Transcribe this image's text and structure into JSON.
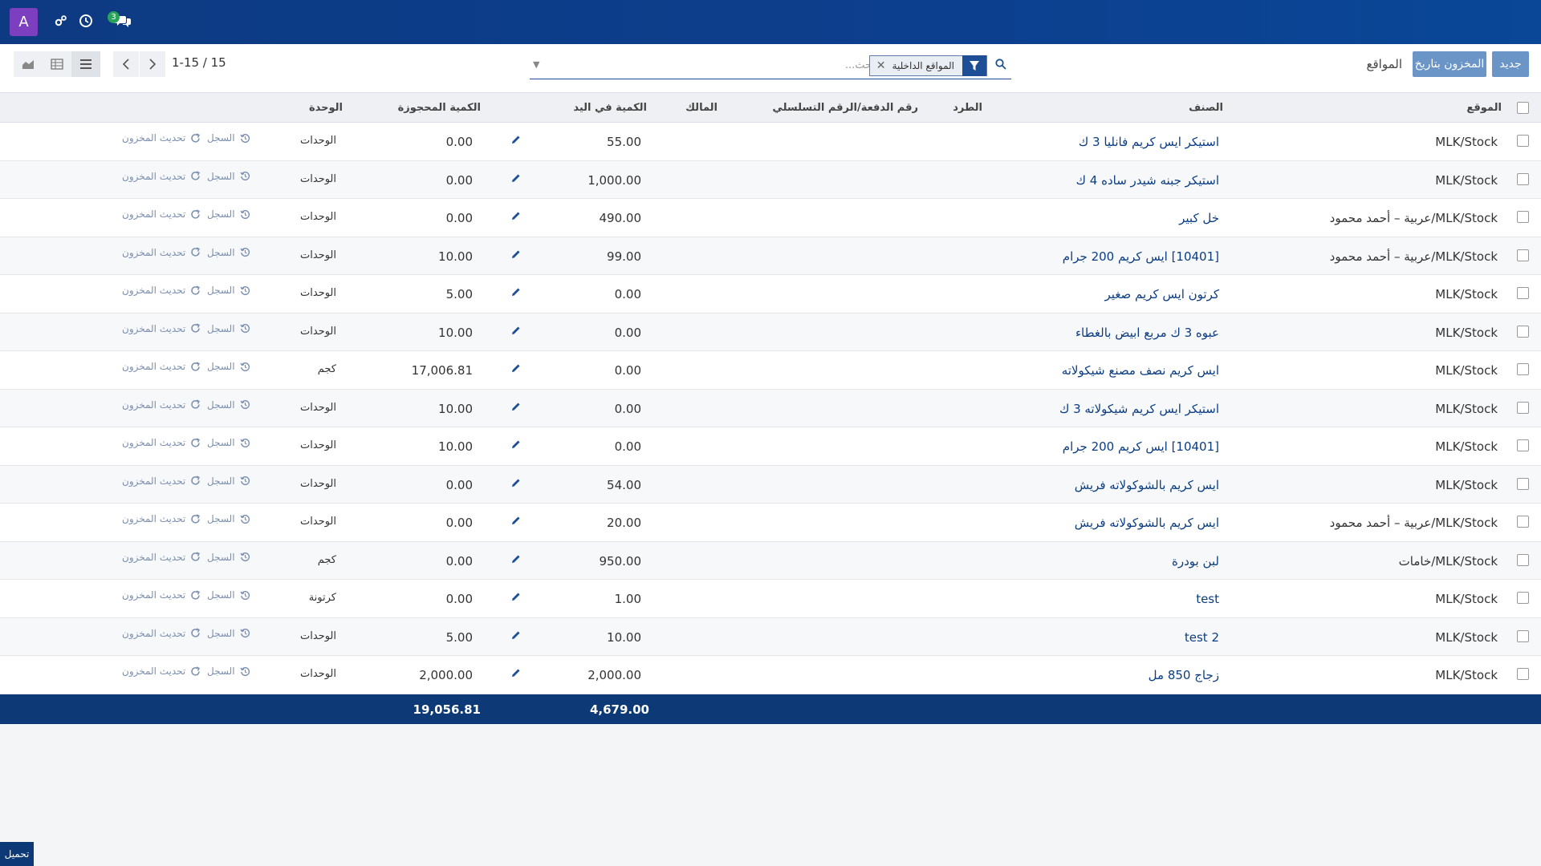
{
  "topbar": {
    "avatar_letter": "A",
    "icons": [
      "tools-icon",
      "clock-icon",
      "chat-icon"
    ],
    "chat_badge": "3",
    "color": "#0d3a82"
  },
  "control": {
    "new_button": "جديد",
    "inventory_at_date_button": "المخزون بتاريخ",
    "breadcrumb": "المواقع",
    "facet_label": "المواقع الداخلية",
    "search_placeholder": "بحث...",
    "pager_text": "1-15 / 15"
  },
  "columns": {
    "location": "الموقع",
    "product": "الصنف",
    "package": "الطرد",
    "lot": "رقم الدفعة/الرقم التسلسلي",
    "owner": "المالك",
    "on_hand": "الكمية في اليد",
    "reserved": "الكمية المحجوزة",
    "uom": "الوحدة"
  },
  "row_actions": {
    "history": "السجل",
    "update": "تحديث المخزون"
  },
  "rows": [
    {
      "location": "MLK/Stock",
      "product": "استيكر ايس كريم فانليا 3 ك",
      "on_hand": "55.00",
      "reserved": "0.00",
      "uom": "الوحدات"
    },
    {
      "location": "MLK/Stock",
      "product": "استيكر جبنه شيدر ساده 4 ك",
      "on_hand": "1,000.00",
      "reserved": "0.00",
      "uom": "الوحدات"
    },
    {
      "location": "MLK/Stock/عربية – أحمد محمود",
      "product": "خل كبير",
      "on_hand": "490.00",
      "reserved": "0.00",
      "uom": "الوحدات"
    },
    {
      "location": "MLK/Stock/عربية – أحمد محمود",
      "product": "[10401] ايس كريم 200 جرام",
      "on_hand": "99.00",
      "reserved": "10.00",
      "uom": "الوحدات"
    },
    {
      "location": "MLK/Stock",
      "product": "كرتون ايس كريم صغير",
      "on_hand": "0.00",
      "reserved": "5.00",
      "uom": "الوحدات"
    },
    {
      "location": "MLK/Stock",
      "product": "عبوه 3 ك مربع ابيض بالغطاء",
      "on_hand": "0.00",
      "reserved": "10.00",
      "uom": "الوحدات"
    },
    {
      "location": "MLK/Stock",
      "product": "ايس كريم نصف مصنع شيكولاته",
      "on_hand": "0.00",
      "reserved": "17,006.81",
      "uom": "كجم"
    },
    {
      "location": "MLK/Stock",
      "product": "استيكر ايس كريم شيكولاته 3 ك",
      "on_hand": "0.00",
      "reserved": "10.00",
      "uom": "الوحدات"
    },
    {
      "location": "MLK/Stock",
      "product": "[10401] ايس كريم 200 جرام",
      "on_hand": "0.00",
      "reserved": "10.00",
      "uom": "الوحدات"
    },
    {
      "location": "MLK/Stock",
      "product": "ايس كريم بالشوكولاته فريش",
      "on_hand": "54.00",
      "reserved": "0.00",
      "uom": "الوحدات"
    },
    {
      "location": "MLK/Stock/عربية – أحمد محمود",
      "product": "ايس كريم بالشوكولاته فريش",
      "on_hand": "20.00",
      "reserved": "0.00",
      "uom": "الوحدات"
    },
    {
      "location": "MLK/Stock/خامات",
      "product": "لبن بودرة",
      "on_hand": "950.00",
      "reserved": "0.00",
      "uom": "كجم"
    },
    {
      "location": "MLK/Stock",
      "product": "test",
      "on_hand": "1.00",
      "reserved": "0.00",
      "uom": "كرتونة"
    },
    {
      "location": "MLK/Stock",
      "product": "test 2",
      "on_hand": "10.00",
      "reserved": "5.00",
      "uom": "الوحدات"
    },
    {
      "location": "MLK/Stock",
      "product": "زجاج 850 مل",
      "on_hand": "2,000.00",
      "reserved": "2,000.00",
      "uom": "الوحدات"
    }
  ],
  "totals": {
    "on_hand": "4,679.00",
    "reserved": "19,056.81"
  },
  "footer": {
    "download_label": "تحميل"
  }
}
